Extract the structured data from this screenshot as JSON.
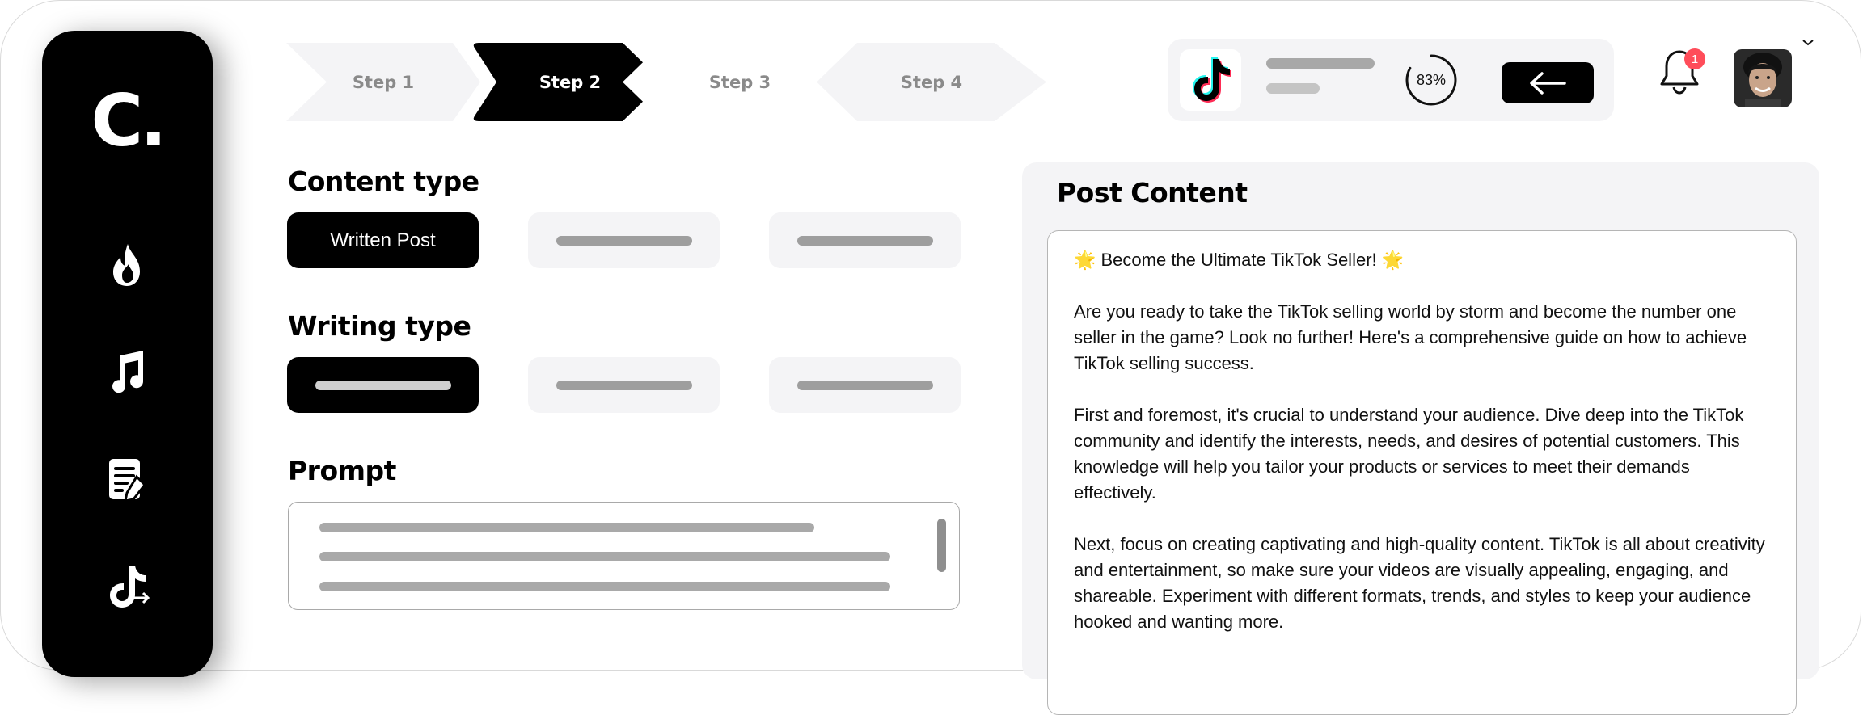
{
  "app": {
    "logo_text": "C."
  },
  "steps": [
    {
      "label": "Step 1",
      "state": "done"
    },
    {
      "label": "Step 2",
      "state": "active"
    },
    {
      "label": "Step 3",
      "state": "upcoming"
    },
    {
      "label": "Step 4",
      "state": "upcoming"
    }
  ],
  "sidebar": {
    "items": [
      {
        "icon": "flame-icon"
      },
      {
        "icon": "music-note-icon"
      },
      {
        "icon": "document-edit-icon"
      },
      {
        "icon": "tiktok-icon"
      }
    ]
  },
  "status": {
    "platform_icon": "tiktok-icon",
    "progress_percent": 83,
    "progress_label": "83%",
    "back_icon": "arrow-left-icon"
  },
  "notifications": {
    "count": "1"
  },
  "content_type": {
    "title": "Content type",
    "options": [
      {
        "label": "Written Post",
        "selected": true
      },
      {
        "label": "",
        "selected": false
      },
      {
        "label": "",
        "selected": false
      }
    ]
  },
  "writing_type": {
    "title": "Writing type",
    "options": [
      {
        "label": "",
        "selected": true
      },
      {
        "label": "",
        "selected": false
      },
      {
        "label": "",
        "selected": false
      }
    ]
  },
  "prompt": {
    "title": "Prompt"
  },
  "post": {
    "title": "Post Content",
    "paragraphs": [
      "🌟 Become the Ultimate TikTok Seller! 🌟",
      "Are you ready to take the TikTok selling world by storm and become the number one seller in the game? Look no further! Here's a comprehensive guide on how to achieve TikTok selling success.",
      "First and foremost, it's crucial to understand your audience. Dive deep into the TikTok community and identify the interests, needs, and desires of potential customers. This knowledge will help you tailor your products or services to meet their demands effectively.",
      "Next, focus on creating captivating and high-quality content. TikTok is all about creativity and entertainment, so make sure your videos are visually appealing, engaging, and shareable. Experiment with different formats, trends, and styles to keep your audience hooked and wanting more."
    ]
  },
  "colors": {
    "accent": "#000000",
    "panel": "#f4f4f6",
    "badge": "#ff4d5a",
    "step_inactive": "#f4f4f6"
  }
}
